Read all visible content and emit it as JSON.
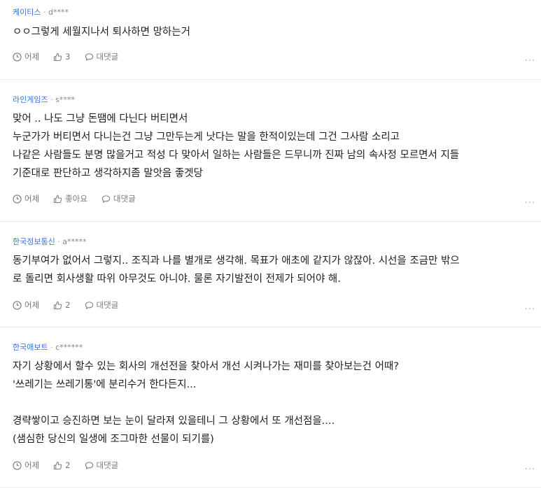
{
  "comments": [
    {
      "company": "케이티스",
      "user": "d****",
      "lines": [
        "ㅇㅇ그렇게 세월지나서 퇴사하면 망하는거"
      ],
      "time": "어제",
      "like": "3",
      "reply": "대댓글"
    },
    {
      "company": "라인게임즈",
      "user": "s****",
      "lines": [
        "맞어 .. 나도 그냥 돈땜에 다닌다 버티면서",
        "누군가가 버티면서 다니는건 그냥 그만두는게 낫다는 말을 한적이있는데 그건 그사람 소리고",
        "나같은 사람들도 분명 많을거고 적성 다 맞아서 일하는 사람들은 드무니까 진짜 남의 속사정 모르면서 지들",
        "기준대로 판단하고 생각하지좀 말앗음 좋겟당"
      ],
      "time": "어제",
      "like": "좋아요",
      "reply": "대댓글"
    },
    {
      "company": "한국정보통신",
      "user": "a*****",
      "lines": [
        "동기부여가 없어서 그렇지.. 조직과 나를 별개로 생각해. 목표가 애초에 같지가 않잖아. 시선을 조금만 밖으",
        "로 돌리면 회사생활 따위 아무것도 아니야. 물론 자기발전이 전제가 되어야 해."
      ],
      "time": "어제",
      "like": "2",
      "reply": "대댓글"
    },
    {
      "company": "한국애보트",
      "user": "c******",
      "lines": [
        "자기 상황에서 할수 있는 회사의 개선전을 찾아서 개선 시켜나가는 재미를 찾아보는건 어때?",
        "'쓰레기는 쓰레기통'에 분리수거 한다든지...",
        "",
        "경략쌓이고 승진하면 보는 눈이 달라져 있을테니 그 상황에서 또 개선점을....",
        "(샘심한 당신의 일생에 조그마한 선물이 되기를)"
      ],
      "time": "어제",
      "like": "2",
      "reply": "대댓글"
    }
  ],
  "separator": "·",
  "more_label": "...",
  "icons": {
    "time": "clock-icon",
    "like": "thumbs-up-icon",
    "reply": "speech-bubble-icon"
  },
  "colors": {
    "company": "#3e74d6",
    "meta": "#888888",
    "text": "#1e1e1e"
  }
}
